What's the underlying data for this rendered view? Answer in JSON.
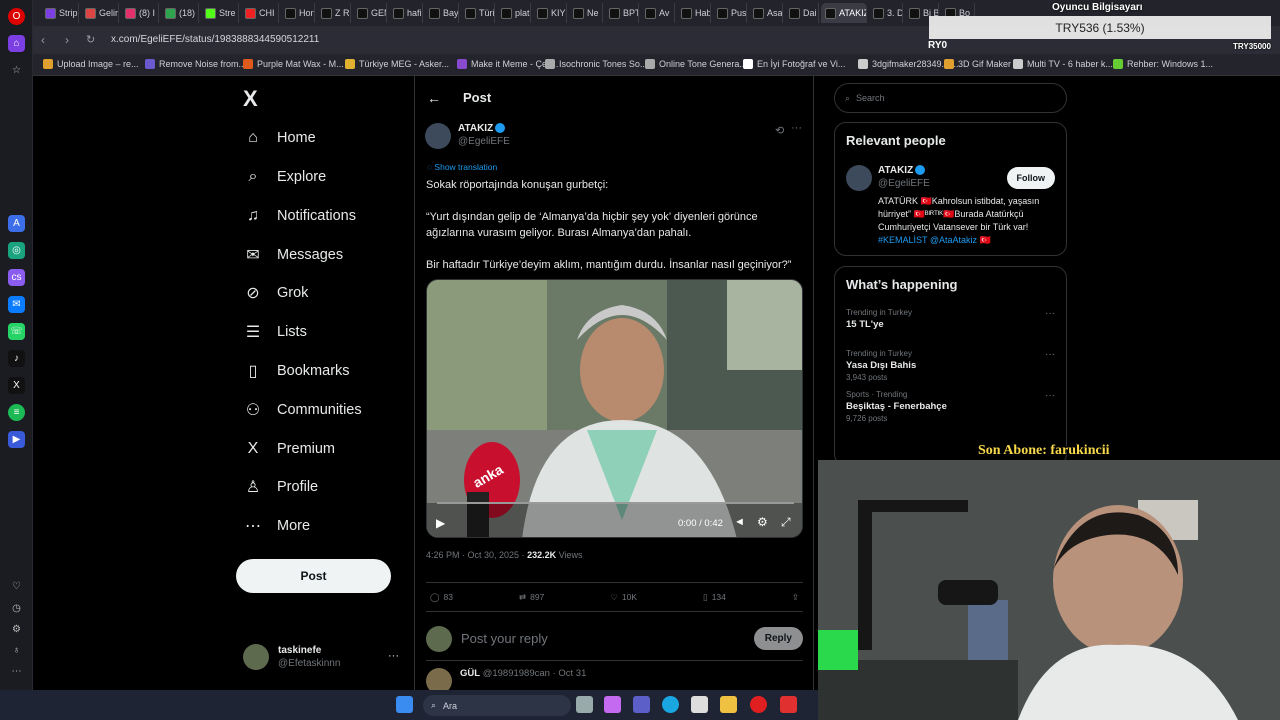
{
  "browser": {
    "tabs": [
      {
        "label": "Strip",
        "color": "#7b3fe4"
      },
      {
        "label": "Gelir",
        "color": "#d44"
      },
      {
        "label": "(8) I",
        "color": "#e1306c"
      },
      {
        "label": "(18)",
        "color": "#2ea44f"
      },
      {
        "label": "Stre",
        "color": "#53fc18"
      },
      {
        "label": "CHI",
        "color": "#e22"
      },
      {
        "label": "Hon",
        "color": "#111"
      },
      {
        "label": "Z R",
        "color": "#111"
      },
      {
        "label": "GEN",
        "color": "#111"
      },
      {
        "label": "hafi",
        "color": "#111"
      },
      {
        "label": "Bay",
        "color": "#111"
      },
      {
        "label": "Türi",
        "color": "#111"
      },
      {
        "label": "plat",
        "color": "#111"
      },
      {
        "label": "KIY",
        "color": "#111"
      },
      {
        "label": "Ne",
        "color": "#111"
      },
      {
        "label": "BPT",
        "color": "#111"
      },
      {
        "label": "Av",
        "color": "#111"
      },
      {
        "label": "Hab",
        "color": "#111"
      },
      {
        "label": "Pusi",
        "color": "#111"
      },
      {
        "label": "Asa",
        "color": "#111"
      },
      {
        "label": "Dai",
        "color": "#111"
      },
      {
        "label": "ATAKIZ",
        "color": "#111",
        "active": true
      },
      {
        "label": "3. D",
        "color": "#111"
      },
      {
        "label": "Bi B",
        "color": "#111"
      },
      {
        "label": "Bo",
        "color": "#111"
      }
    ],
    "url": "x.com/EgeliEFE/status/1983888344590512211",
    "bookmarks": [
      {
        "label": "Upload Image – re...",
        "color": "#e0a030"
      },
      {
        "label": "Remove Noise from...",
        "color": "#6a5acd"
      },
      {
        "label": "Purple Mat Wax - M...",
        "color": "#e05a20"
      },
      {
        "label": "Türkiye MEG - Asker...",
        "color": "#e0b030"
      },
      {
        "label": "Make it Meme - Çev...",
        "color": "#8a4ad0"
      },
      {
        "label": "Isochronic Tones So...",
        "color": "#aaa"
      },
      {
        "label": "Online Tone Genera...",
        "color": "#aaa"
      },
      {
        "label": "En İyi Fotoğraf ve Vi...",
        "color": "#fff"
      },
      {
        "label": "3dgifmaker28349.gi...",
        "color": "#ccc"
      },
      {
        "label": "3D Gif Maker",
        "color": "#e0a030"
      },
      {
        "label": "Multi TV - 6 haber k...",
        "color": "#ccc"
      },
      {
        "label": "Rehber: Windows 1...",
        "color": "#6c3"
      }
    ]
  },
  "nav": {
    "logo": "X",
    "items": [
      {
        "label": "Home",
        "icon": "home-icon"
      },
      {
        "label": "Explore",
        "icon": "search-icon"
      },
      {
        "label": "Notifications",
        "icon": "bell-icon"
      },
      {
        "label": "Messages",
        "icon": "envelope-icon"
      },
      {
        "label": "Grok",
        "icon": "grok-icon"
      },
      {
        "label": "Lists",
        "icon": "list-icon"
      },
      {
        "label": "Bookmarks",
        "icon": "bookmark-icon"
      },
      {
        "label": "Communities",
        "icon": "people-icon"
      },
      {
        "label": "Premium",
        "icon": "x-icon"
      },
      {
        "label": "Profile",
        "icon": "person-icon"
      },
      {
        "label": "More",
        "icon": "more-circle-icon"
      }
    ],
    "post_button": "Post",
    "me": {
      "name": "taskinefe",
      "handle": "@Efetaskinnn"
    }
  },
  "post": {
    "header": "Post",
    "author_name": "ATAKIZ",
    "author_handle": "@EgeliEFE",
    "translate": "Show translation",
    "paragraphs": [
      "Sokak röportajında konuşan gurbetçi:",
      "“Yurt dışından gelip de ‘Almanya’da hiçbir şey yok’ diyenleri görünce ağızlarına vurasım geliyor. Burası Almanya’dan pahalı.",
      "Bir haftadır Türkiye’deyim aklım, mantığım durdu. İnsanlar nasıl geçiniyor?”"
    ],
    "video_time": "0:00 / 0:42",
    "video_watermark": "anka",
    "timestamp": "4:26 PM · Oct 30, 2025 · ",
    "views_count": "232.2K",
    "views_label": " Views",
    "stats": {
      "replies": "83",
      "reposts": "897",
      "likes": "10K",
      "bookmarks": "134"
    },
    "reply_placeholder": "Post your reply",
    "reply_button": "Reply",
    "comment": {
      "name": "GÜL",
      "handle": "@19891989can · Oct 31"
    }
  },
  "sidebar": {
    "search_placeholder": "Search",
    "relevant_title": "Relevant people",
    "person_name": "ATAKIZ",
    "person_handle": "@EgeliEFE",
    "follow": "Follow",
    "bio": "ATATÜRK 🇹🇷Kahrolsun istibdat, yaşasın hürriyet” 🇹🇷ᴮᴵᴿᵀᴵᴷ🇹🇷Burada Atatürkçü Cumhuriyetçi Vatansever bir Türk var!",
    "bio_tags": "#KEMALİST @AtaAtakiz 🇹🇷",
    "happening_title": "What’s happening",
    "trends": [
      {
        "category": "Trending in Turkey",
        "title": "15 TL'ye",
        "count": ""
      },
      {
        "category": "Trending in Turkey",
        "title": "Yasa Dışı Bahis",
        "count": "3,943 posts"
      },
      {
        "category": "Sports · Trending",
        "title": "Beşiktaş - Fenerbahçe",
        "count": "9,726 posts"
      }
    ]
  },
  "overlay": {
    "ticker": "TRY536 (1.53%)",
    "ticker_left": "RY0",
    "ticker_small": "TRY35000",
    "pc_label": "Oyuncu Bilgisayarı",
    "subscriber": "Son Abone: farukincii"
  },
  "taskbar": {
    "search": "Ara"
  }
}
